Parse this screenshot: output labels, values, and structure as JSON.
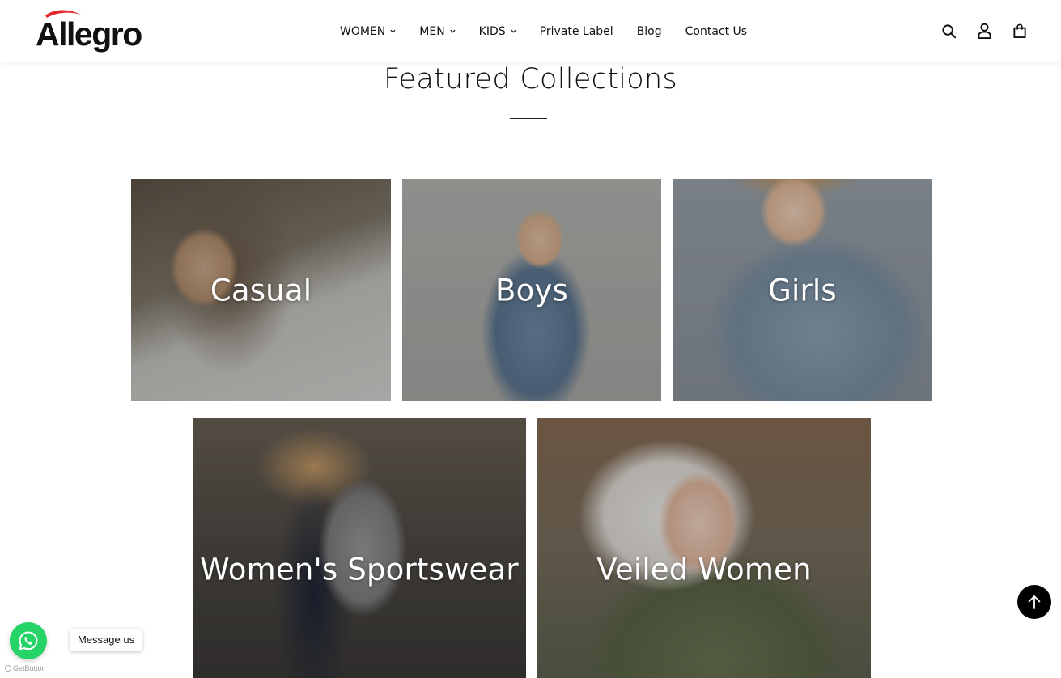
{
  "brand": {
    "logo_text": "Allegro",
    "accent_color": "#e2262b"
  },
  "nav": {
    "items": [
      {
        "label": "WOMEN",
        "has_dropdown": true
      },
      {
        "label": "MEN",
        "has_dropdown": true
      },
      {
        "label": "KIDS",
        "has_dropdown": true
      },
      {
        "label": "Private Label",
        "has_dropdown": false
      },
      {
        "label": "Blog",
        "has_dropdown": false
      },
      {
        "label": "Contact Us",
        "has_dropdown": false
      }
    ]
  },
  "header_icons": [
    "search-icon",
    "user-icon",
    "shopping-bag-icon"
  ],
  "featured": {
    "title": "Featured Collections",
    "collections": [
      {
        "label": "Casual"
      },
      {
        "label": "Boys"
      },
      {
        "label": "Girls"
      },
      {
        "label": "Women's Sportswear"
      },
      {
        "label": "Veiled Women"
      }
    ]
  },
  "whatsapp": {
    "tooltip": "Message us",
    "color": "#25d366",
    "powered_by": "GetButton"
  },
  "scroll_top": {
    "icon": "arrow-up-icon"
  }
}
